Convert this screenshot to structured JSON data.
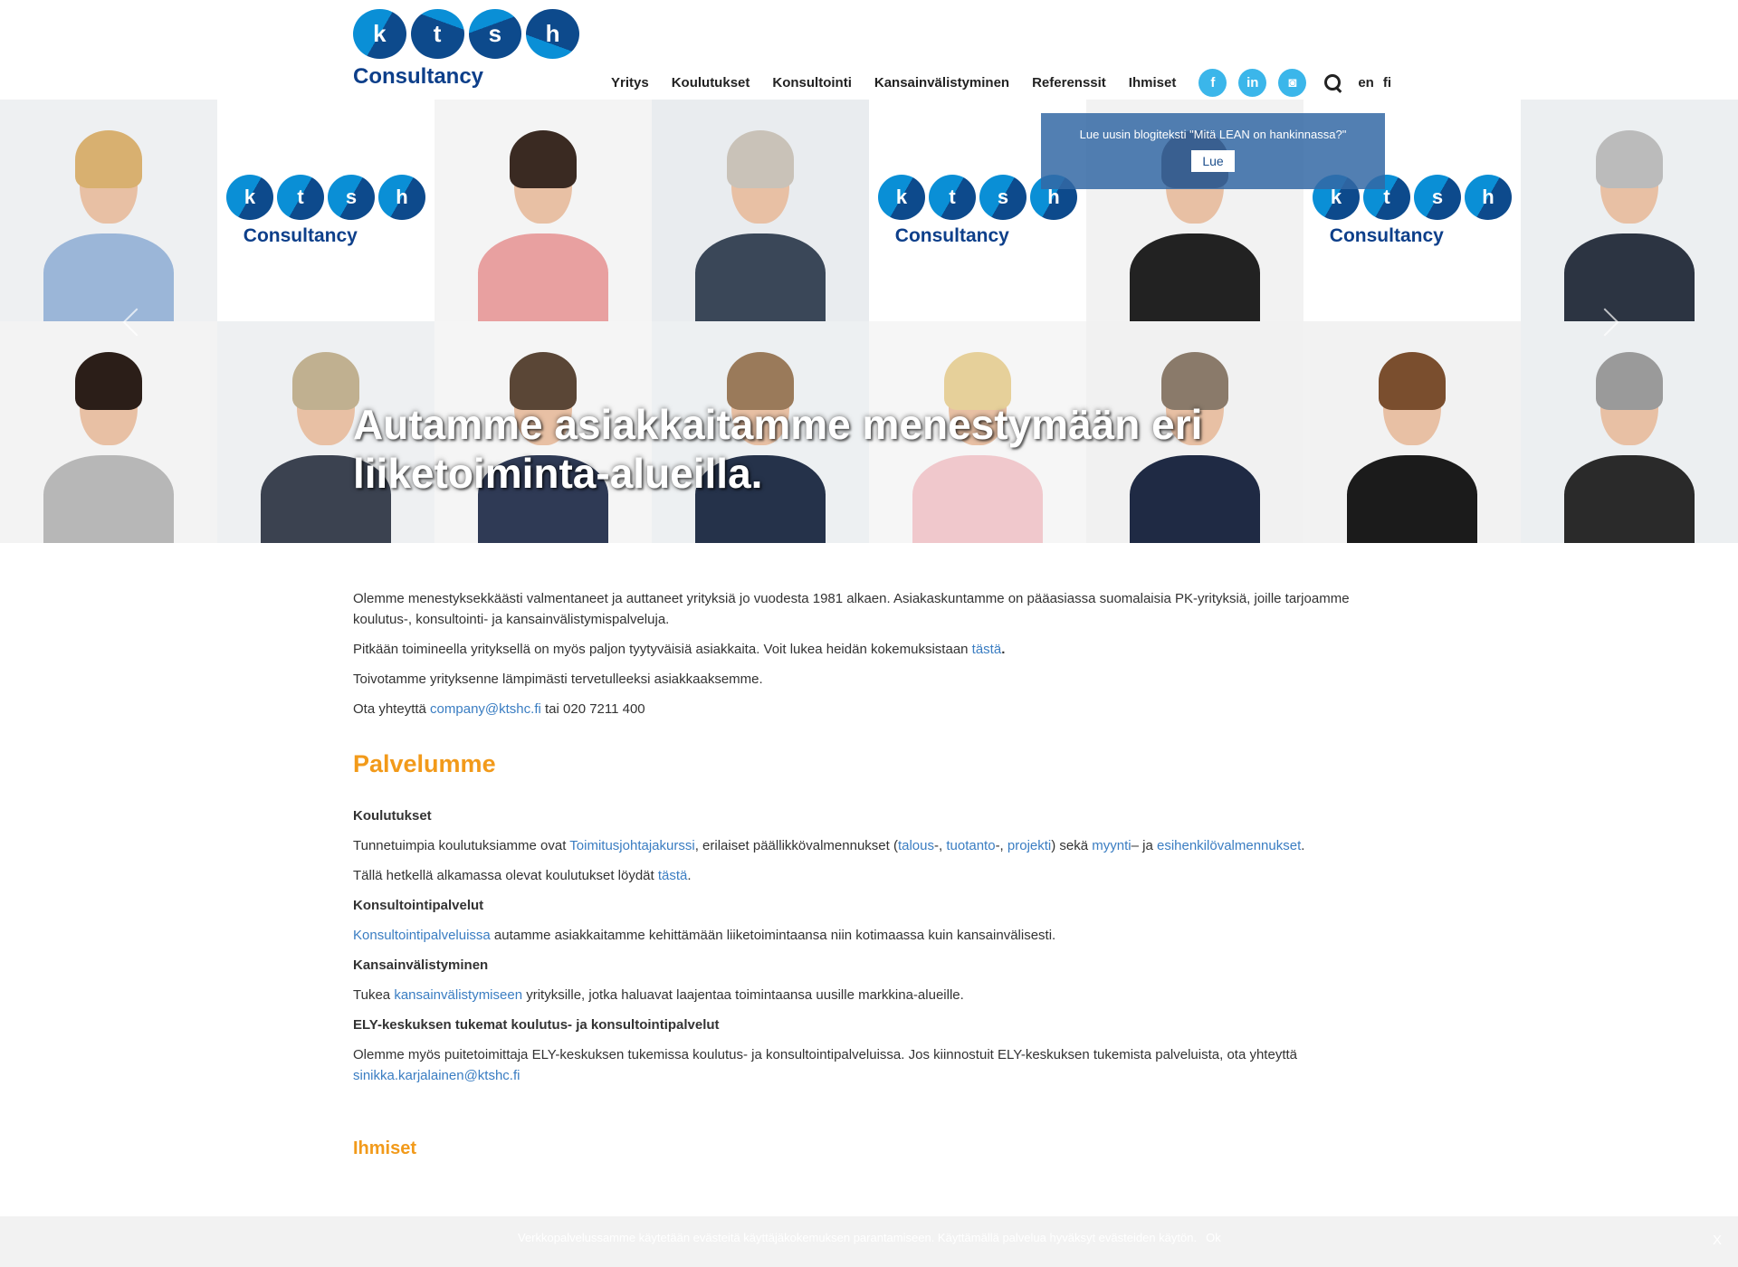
{
  "logo": {
    "letters": [
      "k",
      "t",
      "s",
      "h"
    ],
    "word": "Consultancy"
  },
  "nav": {
    "items": [
      "Yritys",
      "Koulutukset",
      "Konsultointi",
      "Kansainvälistyminen",
      "Referenssit",
      "Ihmiset"
    ],
    "social": [
      {
        "icon": "facebook-icon",
        "glyph": "f"
      },
      {
        "icon": "linkedin-icon",
        "glyph": "in"
      },
      {
        "icon": "instagram-icon",
        "glyph": "◙"
      }
    ],
    "languages": [
      "en",
      "fi"
    ]
  },
  "popup": {
    "text": "Lue uusin blogiteksti \"Mitä LEAN on hankinnassa?\"",
    "button": "Lue"
  },
  "hero": {
    "title": "Autamme asiakkaitamme menestymään eri liiketoiminta-alueilla."
  },
  "intro": {
    "p1": "Olemme menestyksekkäästi valmentaneet ja auttaneet yrityksiä jo vuodesta 1981 alkaen.  Asiakaskuntamme on pääasiassa suomalaisia PK-yrityksiä, joille tarjoamme koulutus-, konsultointi- ja kansainvälistymispalveluja.",
    "p2_pre": "Pitkään toimineella yrityksellä on myös paljon tyytyväisiä asiakkaita. Voit lukea heidän kokemuksistaan ",
    "p2_link": "tästä",
    "p2_post": ".",
    "p3": "Toivotamme yrityksenne lämpimästi tervetulleeksi asiakkaaksemme.",
    "p4_pre": "Ota yhteyttä ",
    "p4_link": "company@ktshc.fi",
    "p4_post": " tai 020 7211 400"
  },
  "services": {
    "title": "Palvelumme",
    "koulutukset": {
      "heading": "Koulutukset",
      "t1": "Tunnetuimpia koulutuksiamme ovat ",
      "l1": "Toimitusjohtajakurssi",
      "t2": ", erilaiset päällikkövalmennukset (",
      "l2": "talous",
      "t3": "-, ",
      "l3": "tuotanto",
      "t4": "-, ",
      "l4": "projekti",
      "t5": ") sekä ",
      "l5": "myynti",
      "t6": "– ja ",
      "l6": "esihenkilövalmennukset",
      "t7": ".",
      "s1": "Tällä hetkellä alkamassa olevat koulutukset löydät ",
      "s_link": "tästä",
      "s2": "."
    },
    "konsultointi": {
      "heading": "Konsultointipalvelut",
      "link": "Konsultointipalveluissa",
      "text": " autamme asiakkaitamme kehittämään liiketoimintaansa niin kotimaassa kuin kansainvälisesti."
    },
    "kansainvalistyminen": {
      "heading": "Kansainvälistyminen",
      "pre": "Tukea ",
      "link": "kansainvälistymiseen",
      "text": " yrityksille, jotka haluavat laajentaa toimintaansa uusille markkina-alueille."
    },
    "ely": {
      "heading": "ELY-keskuksen tukemat koulutus- ja konsultointipalvelut",
      "text": "Olemme myös puitetoimittaja ELY-keskuksen tukemissa koulutus- ja konsultointipalveluissa. Jos kiinnostuit ELY-keskuksen tukemista palveluista, ota yhteyttä ",
      "link": "sinikka.karjalainen@ktshc.fi"
    }
  },
  "people": {
    "title": "Ihmiset"
  },
  "cookie": {
    "text": "Verkkopalvelussamme käytetään evästeitä käyttäjäkokemuksen parantamiseen. Käyttämällä palvelua hyväksyt evästeiden käytön.",
    "ok": "Ok",
    "close": "X"
  },
  "colors": {
    "accent": "#f29a1a",
    "link": "#3a7dc2",
    "brand": "#0d3f8a",
    "social": "#3bb6ea"
  }
}
